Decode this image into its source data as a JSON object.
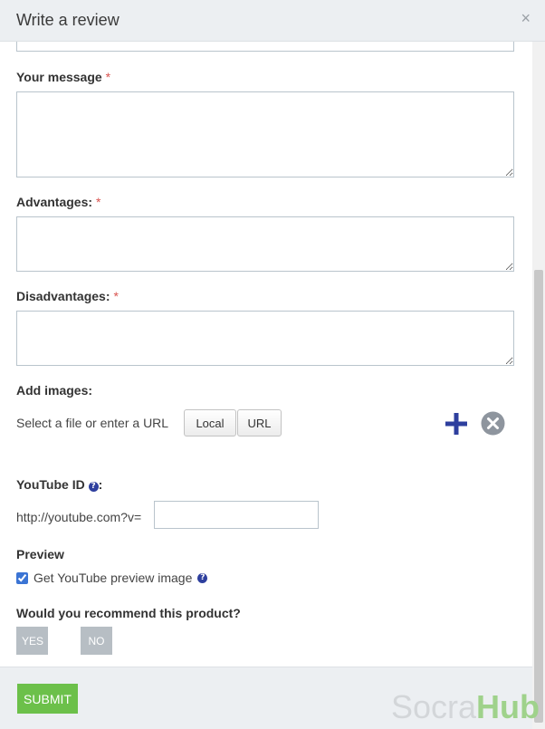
{
  "header": {
    "title": "Write a review",
    "close_label": "×"
  },
  "form": {
    "message_label": "Your message",
    "advantages_label": "Advantages:",
    "disadvantages_label": "Disadvantages:",
    "required_mark": "*",
    "add_images_label": "Add images:",
    "select_file_text": "Select a file or enter a URL",
    "local_button": "Local",
    "url_button": "URL",
    "youtube_label": "YouTube ID",
    "youtube_colon": ":",
    "youtube_prefix": "http://youtube.com?v=",
    "preview_label": "Preview",
    "preview_checkbox_label": "Get YouTube preview image",
    "preview_checked": true,
    "recommend_label": "Would you recommend this product?",
    "yes_button": "YES",
    "no_button": "NO"
  },
  "footer": {
    "submit_button": "SUBMIT"
  },
  "watermark": {
    "part1": "Socra",
    "part2": "Hub"
  },
  "colors": {
    "accent_blue": "#2e3f9e",
    "remove_gray": "#8e959e",
    "submit_green": "#6cc04a",
    "required_red": "#d9534f"
  },
  "icons": {
    "add": "plus-icon",
    "remove": "close-circle-icon",
    "help": "question-circle-icon"
  }
}
